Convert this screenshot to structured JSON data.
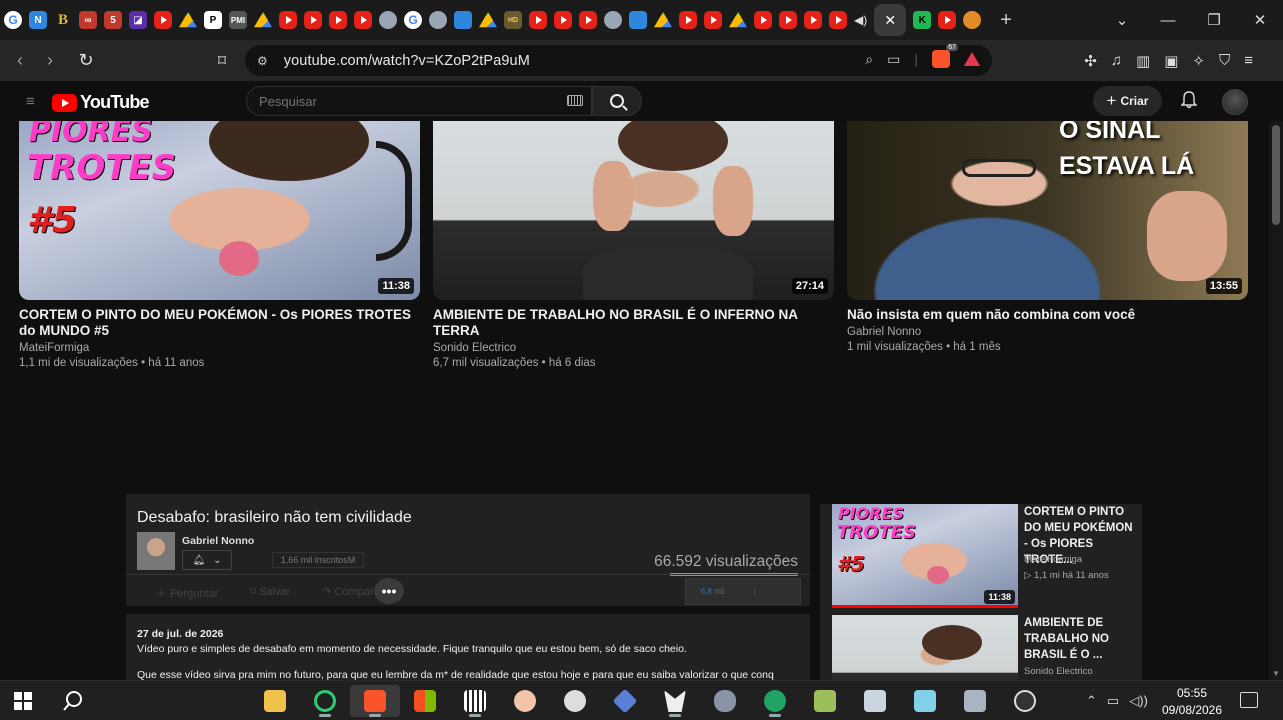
{
  "browser": {
    "tabs_favicons": [
      "google-icon",
      "brave-news-icon",
      "bold-b-icon",
      "link-icon",
      "red-app-icon",
      "purple-app-icon",
      "youtube-icon",
      "drive-icon",
      "pinterest-like-icon",
      "pmi-icon",
      "drive-icon",
      "youtube-icon",
      "youtube-icon",
      "youtube-icon",
      "youtube-icon",
      "cat-icon",
      "google-icon",
      "cat-icon",
      "blue-box-icon",
      "drive-icon",
      "hd-icon",
      "youtube-icon",
      "youtube-icon",
      "youtube-icon",
      "cat-icon",
      "blue-box-icon",
      "drive-icon",
      "drive-icon",
      "youtube-icon",
      "youtube-icon",
      "drive-icon",
      "youtube-icon",
      "youtube-icon",
      "youtube-icon",
      "youtube-icon"
    ],
    "active_tab_close": "✕",
    "extra_tabs": [
      "kick-icon",
      "youtube-icon",
      "orange-icon"
    ],
    "new_tab": "+",
    "url": "youtube.com/watch?v=KZoP2tPa9uM",
    "brave_shield_count": "67"
  },
  "youtube": {
    "logo_text": "YouTube",
    "search_placeholder": "Pesquisar",
    "create_label": "Criar",
    "videos": [
      {
        "title": "CORTEM O PINTO DO MEU POKÉMON - Os PIORES TROTES do MUNDO #5",
        "channel": "MateiFormiga",
        "meta": "1,1 mi de visualizações • há 11 anos",
        "duration": "11:38",
        "overlay": [
          "PIORES",
          "TROTES",
          "#5"
        ]
      },
      {
        "title": "AMBIENTE DE TRABALHO NO BRASIL É O INFERNO NA TERRA",
        "channel": "Sonido Electrico",
        "meta": "6,7 mil visualizações • há 6 dias",
        "duration": "27:14"
      },
      {
        "title": "Não insista em quem não combina com você",
        "channel": "Gabriel Nonno",
        "meta": "1 mil visualizações • há 1 mês",
        "duration": "13:55",
        "overlay": [
          "O SINAL",
          "ESTAVA LÁ"
        ]
      }
    ],
    "player": {
      "title": "Desabafo: brasileiro não tem civilidade",
      "channel": "Gabriel Nonno",
      "subscribers": "1,66 mil inscritosM",
      "views": "66.592 visualizações",
      "actions": [
        "Perguntar",
        "Salvar",
        "Compartilhar"
      ],
      "likes": "6,8 mil",
      "more": "•••"
    },
    "description": {
      "date": "27 de jul. de 2026",
      "line1": "Vídeo puro e simples de desabafo em momento de necessidade. Fique tranquilo que eu estou bem, só de saco cheio.",
      "line2": "Que esse vídeo sirva pra mim no futuro, para que eu lembre da m* de realidade que estou hoje e para que eu saiba valorizar o que conq"
    },
    "side": [
      {
        "title": "CORTEM O PINTO DO MEU POKÉMON - Os PIORES TROTE...",
        "channel": "MateiFormiga",
        "meta": "▷ 1,1 mi   há 11 anos",
        "duration": "11:38"
      },
      {
        "title": "AMBIENTE DE TRABALHO NO BRASIL É O ...",
        "channel": "Sonido Electrico"
      }
    ]
  },
  "taskbar": {
    "time": "05:55",
    "date": "09/08/2026"
  },
  "colors": {
    "yt_red": "#ff0000",
    "bg": "#0f0f0f",
    "panel": "#212121",
    "accent_blue": "#3ea6ff"
  }
}
